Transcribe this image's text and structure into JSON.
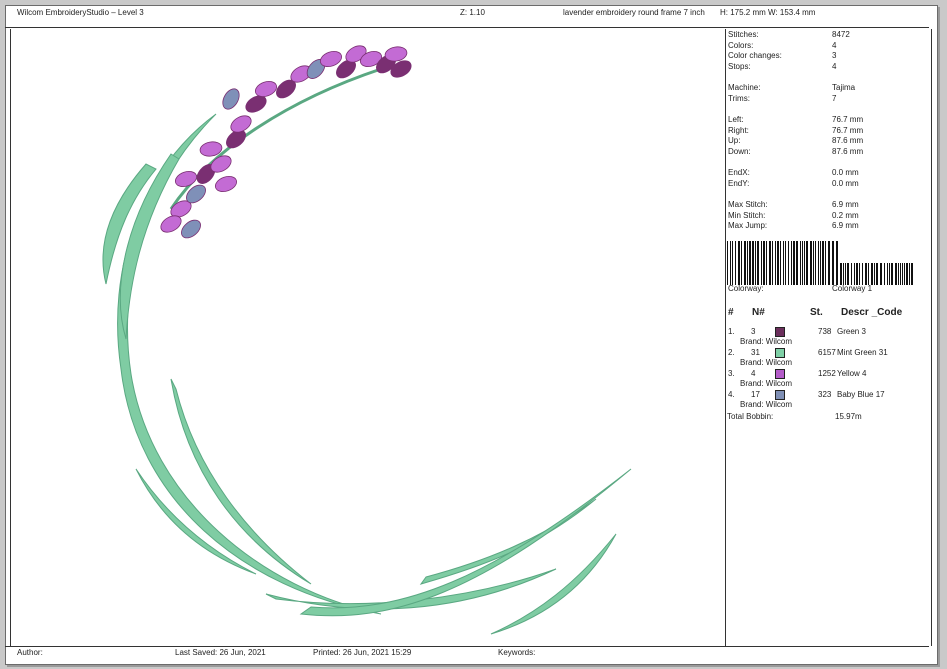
{
  "header": {
    "app_title": "Wilcom EmbroideryStudio – Level 3",
    "zoom": "Z: 1.10",
    "design_name": "lavender embroidery round frame 7 inch",
    "dimensions": "H: 175.2 mm   W: 153.4 mm"
  },
  "stats": {
    "stitches_label": "Stitches:",
    "stitches": "8472",
    "colors_label": "Colors:",
    "colors": "4",
    "color_changes_label": "Color changes:",
    "color_changes": "3",
    "stops_label": "Stops:",
    "stops": "4",
    "machine_label": "Machine:",
    "machine": "Tajima",
    "trims_label": "Trims:",
    "trims": "7",
    "left_label": "Left:",
    "left": "76.7 mm",
    "right_label": "Right:",
    "right": "76.7 mm",
    "up_label": "Up:",
    "up": "87.6 mm",
    "down_label": "Down:",
    "down": "87.6 mm",
    "endx_label": "EndX:",
    "endx": "0.0 mm",
    "endy_label": "EndY:",
    "endy": "0.0 mm",
    "max_stitch_label": "Max Stitch:",
    "max_stitch": "6.9 mm",
    "min_stitch_label": "Min Stitch:",
    "min_stitch": "0.2 mm",
    "max_jump_label": "Max Jump:",
    "max_jump": "6.9 mm"
  },
  "colorway": {
    "label": "Colorway:",
    "value": "Colorway 1"
  },
  "table": {
    "col_num": "#",
    "col_n": "N#",
    "col_st": "St.",
    "col_descr": "Descr _Code",
    "rows": [
      {
        "idx": "1.",
        "n": "3",
        "color": "#6b2f5c",
        "st": "738",
        "descr": "Green 3",
        "brand": "Brand: Wilcom"
      },
      {
        "idx": "2.",
        "n": "31",
        "color": "#7fd0a6",
        "st": "6157",
        "descr": "Mint Green 31",
        "brand": "Brand: Wilcom"
      },
      {
        "idx": "3.",
        "n": "4",
        "color": "#b45cc9",
        "st": "1252",
        "descr": "Yellow 4",
        "brand": "Brand: Wilcom"
      },
      {
        "idx": "4.",
        "n": "17",
        "color": "#7f8fb5",
        "st": "323",
        "descr": "Baby Blue 17",
        "brand": "Brand: Wilcom"
      }
    ],
    "total_label": "Total Bobbin:",
    "total": "15.97m"
  },
  "footer": {
    "author": "Author:",
    "last_saved": "Last Saved: 26 Jun, 2021",
    "printed": "Printed: 26 Jun, 2021 15:29",
    "keywords": "Keywords:"
  },
  "colors": {
    "stem": "#7fcca3",
    "stem_dark": "#5aa882",
    "bud_light": "#c36bd4",
    "bud_dark": "#7a2f72",
    "bud_blue": "#7f90b8"
  }
}
